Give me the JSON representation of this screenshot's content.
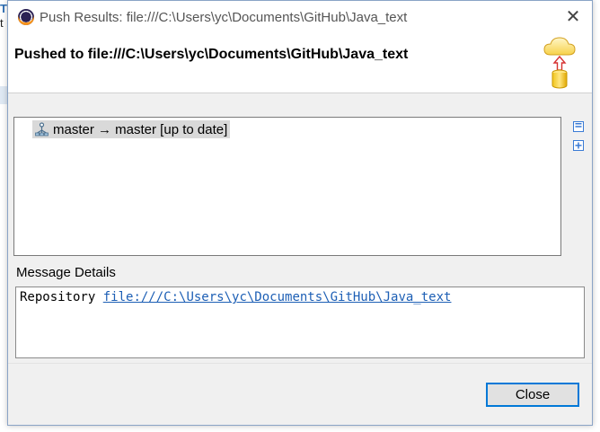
{
  "background": {
    "fragment_1": "T",
    "fragment_2": "t"
  },
  "window": {
    "title": "Push Results: file:///C:\\Users\\yc\\Documents\\GitHub\\Java_text",
    "close_glyph": "✕",
    "app_icon": "eclipse-icon"
  },
  "header": {
    "title": "Pushed to file:///C:\\Users\\yc\\Documents\\GitHub\\Java_text",
    "graphic_icon": "cloud-push-repository-icon"
  },
  "results": {
    "rows": [
      {
        "icon": "branch-icon",
        "label": "master → master [up to date]"
      }
    ],
    "collapse_all_icon": "collapse-all-icon",
    "expand_all_icon": "expand-all-icon"
  },
  "message_details": {
    "label": "Message Details",
    "prefix": "Repository",
    "link": "file:///C:\\Users\\yc\\Documents\\GitHub\\Java_text"
  },
  "footer": {
    "close_label": "Close"
  },
  "colors": {
    "link": "#1d5fb5",
    "button_border": "#0078d7",
    "selection": "#d9d9d9",
    "dialog_bg": "#f0f0f0"
  }
}
